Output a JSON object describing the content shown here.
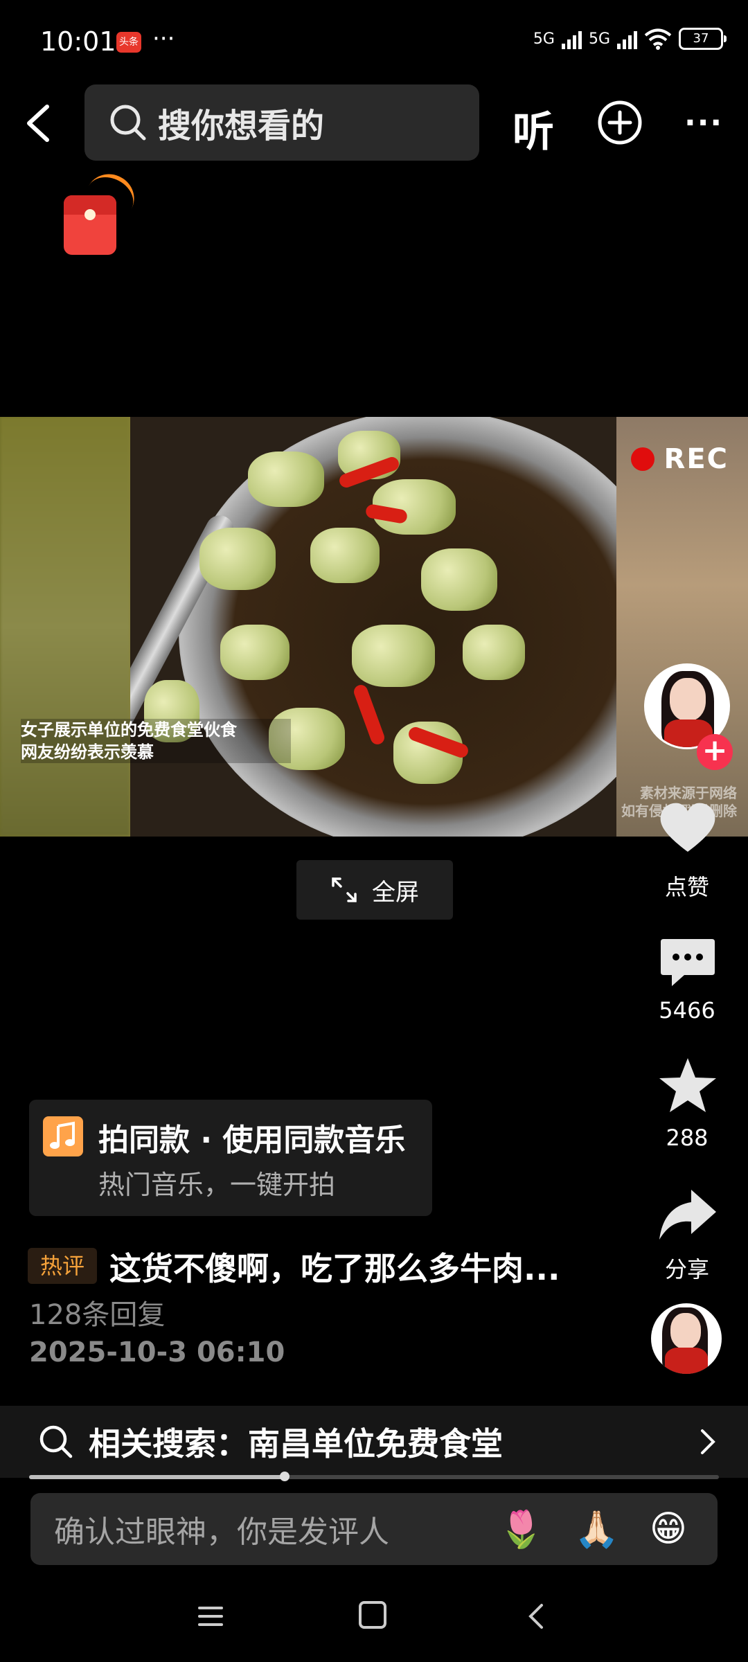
{
  "status_bar": {
    "time": "10:01",
    "app_badge": "头条",
    "dots": "···",
    "network1": "5G",
    "network2": "5G",
    "battery": "37"
  },
  "header": {
    "search_placeholder": "搜你想看的",
    "listen_label": "听",
    "more_label": "···"
  },
  "video": {
    "rec_label": "REC",
    "caption_line1": "女子展示单位的免费食堂伙食",
    "caption_line2": "网友纷纷表示羡慕",
    "watermark_line1": "素材来源于网络",
    "watermark_line2": "如有侵权 联系删除",
    "fullscreen_label": "全屏"
  },
  "actions": {
    "like_label": "点赞",
    "comment_count": "5466",
    "favorite_count": "288",
    "share_label": "分享",
    "follow_symbol": "+"
  },
  "music": {
    "title": "拍同款 · 使用同款音乐",
    "subtitle": "热门音乐，一键开拍"
  },
  "hot_comment": {
    "badge": "热评",
    "text": "这货不傻啊，吃了那么多牛肉...",
    "replies": "128条回复",
    "datetime": "2025-10-3 06:10"
  },
  "related_search": {
    "text": "相关搜索：南昌单位免费食堂"
  },
  "playback": {
    "progress_fraction": 0.37
  },
  "comment_bar": {
    "placeholder": "确认过眼神，你是发评人",
    "emojis": [
      "🌷",
      "🙏🏻",
      "😁"
    ]
  },
  "colors": {
    "background": "#000000",
    "accent_red": "#f7324f",
    "hot_badge_text": "#f5a23a",
    "music_note_bg": "#ffa34a"
  }
}
